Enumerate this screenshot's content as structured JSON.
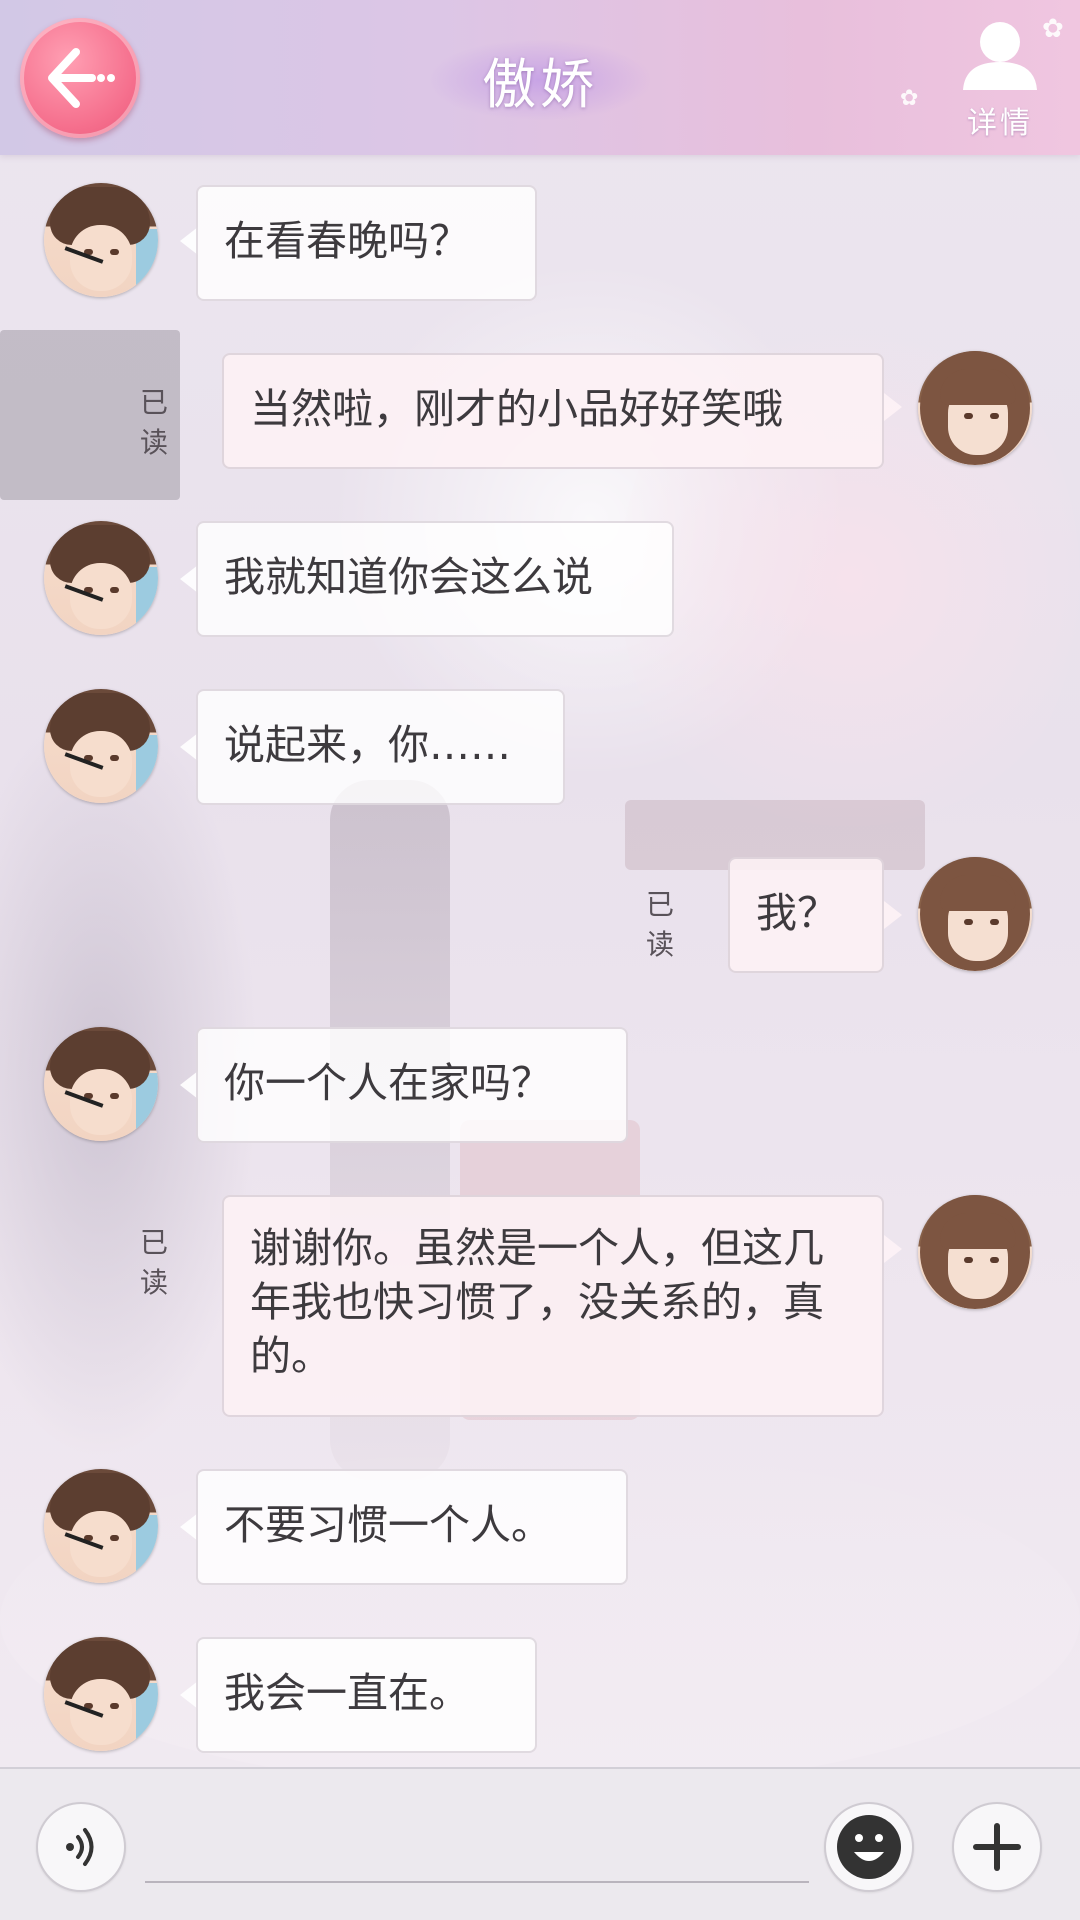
{
  "header": {
    "title": "傲娇",
    "details_label": "详情"
  },
  "colors": {
    "back_button": "#f56e8c",
    "header_start": "#d2c8e6",
    "header_end": "#f0c6e0",
    "bubble_other": "#ffffff",
    "bubble_self": "#fdf1f5",
    "text": "#3d3a3e"
  },
  "icons": {
    "back": "arrow-left-icon",
    "details": "person-icon",
    "voice": "voice-icon",
    "emoji": "emoji-icon",
    "add": "plus-icon"
  },
  "messages": [
    {
      "sender": "other",
      "text": "在看春晚吗？"
    },
    {
      "sender": "self",
      "text": "当然啦，刚才的小品好好笑哦",
      "status": "已读"
    },
    {
      "sender": "other",
      "text": "我就知道你会这么说"
    },
    {
      "sender": "other",
      "text": "说起来，你……"
    },
    {
      "sender": "self",
      "text": "我？",
      "status": "已读"
    },
    {
      "sender": "other",
      "text": "你一个人在家吗？"
    },
    {
      "sender": "self",
      "text": "谢谢你。虽然是一个人，但这几年我也快习惯了，没关系的，真的。",
      "status": "已读"
    },
    {
      "sender": "other",
      "text": "不要习惯一个人。"
    },
    {
      "sender": "other",
      "text": "我会一直在。"
    }
  ],
  "input": {
    "value": "",
    "placeholder": ""
  }
}
